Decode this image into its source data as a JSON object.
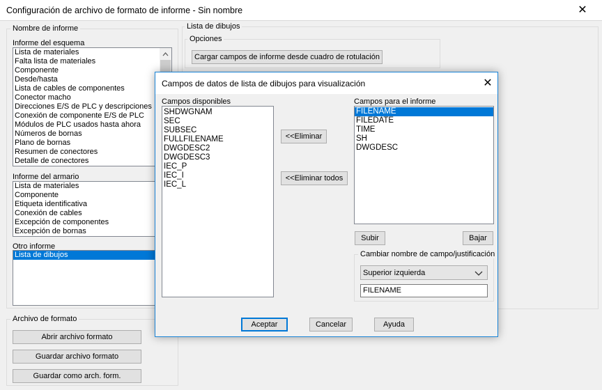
{
  "window": {
    "title": "Configuración de archivo de formato de informe - Sin nombre",
    "close_glyph": "✕"
  },
  "left_panel": {
    "group_label": "Nombre de informe",
    "schematic": {
      "label": "Informe del esquema",
      "items": [
        "Lista de materiales",
        "Falta lista de materiales",
        "Componente",
        "Desde/hasta",
        "Lista de cables de componentes",
        "Conector macho",
        "Direcciones E/S de PLC y descripciones",
        "Conexión de componente E/S de PLC",
        "Módulos de PLC usados hasta ahora",
        "Números de bornas",
        "Plano de bornas",
        "Resumen de conectores",
        "Detalle de conectores"
      ]
    },
    "panel": {
      "label": "Informe del armario",
      "items": [
        "Lista de materiales",
        "Componente",
        "Etiqueta identificativa",
        "Conexión de cables",
        "Excepción de componentes",
        "Excepción de bornas"
      ]
    },
    "other": {
      "label": "Otro informe",
      "items": [
        "Lista de dibujos"
      ],
      "selected_index": 0
    },
    "format_file": {
      "label": "Archivo de formato",
      "open_button": "Abrir archivo formato",
      "save_button": "Guardar archivo formato",
      "save_as_button": "Guardar como arch. form."
    }
  },
  "right_panel": {
    "group_label": "Lista de dibujos",
    "options_label": "Opciones",
    "load_button": "Cargar campos de informe desde cuadro de rotulación"
  },
  "dialog": {
    "title": "Campos de datos de lista de dibujos para visualización",
    "close_glyph": "✕",
    "available_label": "Campos disponibles",
    "available_items": [
      "SHDWGNAM",
      "SEC",
      "SUBSEC",
      "FULLFILENAME",
      "DWGDESC2",
      "DWGDESC3",
      "IEC_P",
      "IEC_I",
      "IEC_L"
    ],
    "remove_button": "<<Eliminar",
    "remove_all_button": "<<Eliminar todos",
    "report_label": "Campos para el informe",
    "report_items": [
      "FILENAME",
      "FILEDATE",
      "TIME",
      "SH",
      "DWGDESC"
    ],
    "report_selected_index": 0,
    "up_button": "Subir",
    "down_button": "Bajar",
    "rename_label": "Cambiar nombre de campo/justificación",
    "justification_value": "Superior izquierda",
    "field_name_value": "FILENAME",
    "ok_button": "Aceptar",
    "cancel_button": "Cancelar",
    "help_button": "Ayuda"
  }
}
